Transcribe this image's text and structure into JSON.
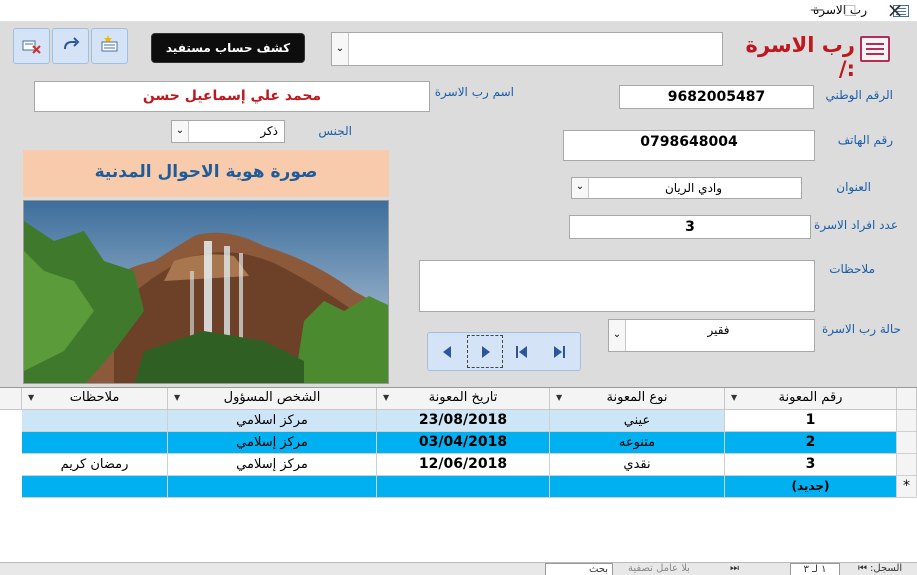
{
  "window": {
    "title": "رب الاسرة",
    "controls": [
      "×",
      "□",
      "—"
    ]
  },
  "header": {
    "form_title": "رب الاسرة :/",
    "account_button": "كشف حساب مستفيد",
    "search_combo_value": "",
    "toolbar_icons": [
      "delete-record-icon",
      "redo-icon",
      "new-record-icon"
    ]
  },
  "form": {
    "national_id_label": "الرقم الوطني",
    "national_id": "9682005487",
    "head_name_label": "اسم رب الاسرة",
    "head_name": "محمد علي إسماعيل حسن",
    "phone_label": "رقم الهاتف",
    "phone": "0798648004",
    "gender_label": "الجنس",
    "gender": "ذكر",
    "address_label": "العنوان",
    "address": "وادي الريان",
    "family_count_label": "عدد افراد الاسرة",
    "family_count": "3",
    "notes_label": "ملاحظات",
    "notes": "",
    "status_label": "حالة رب الاسرة",
    "status": "فقير",
    "photo_header": "صورة هوية الاحوال المدنية"
  },
  "navigator": {
    "icons": [
      "prev-record-icon",
      "next-record-icon",
      "first-record-icon",
      "last-record-icon"
    ]
  },
  "grid": {
    "columns": [
      "رقم المعونة",
      "نوع المعونة",
      "تاريخ المعونة",
      "الشخص المسؤول",
      "ملاحظات"
    ],
    "rows": [
      [
        "1",
        "عيني",
        "23/08/2018",
        "مركز اسلامي",
        ""
      ],
      [
        "2",
        "متنوعه",
        "03/04/2018",
        "مركز إسلامي",
        ""
      ],
      [
        "3",
        "نقدي",
        "12/06/2018",
        "مركز إسلامي",
        "رمضان كريم"
      ]
    ],
    "new_row_label": "(جديد)",
    "new_row_marker": "*",
    "colors": {
      "row_selected": "#cde6f7",
      "row_alt": "#00b0f0",
      "row_normal": "#ffffff"
    }
  },
  "statusbar": {
    "record_label": "السجل:",
    "record_pos": "١ لـ ٣",
    "filter": "بلا عامل تصفية",
    "search": "بحث"
  },
  "colors": {
    "title_red": "#c0161d",
    "label_blue": "#1a5fa8",
    "photo_header_bg": "#f8cbad",
    "accent_blue": "#00b0f0"
  }
}
